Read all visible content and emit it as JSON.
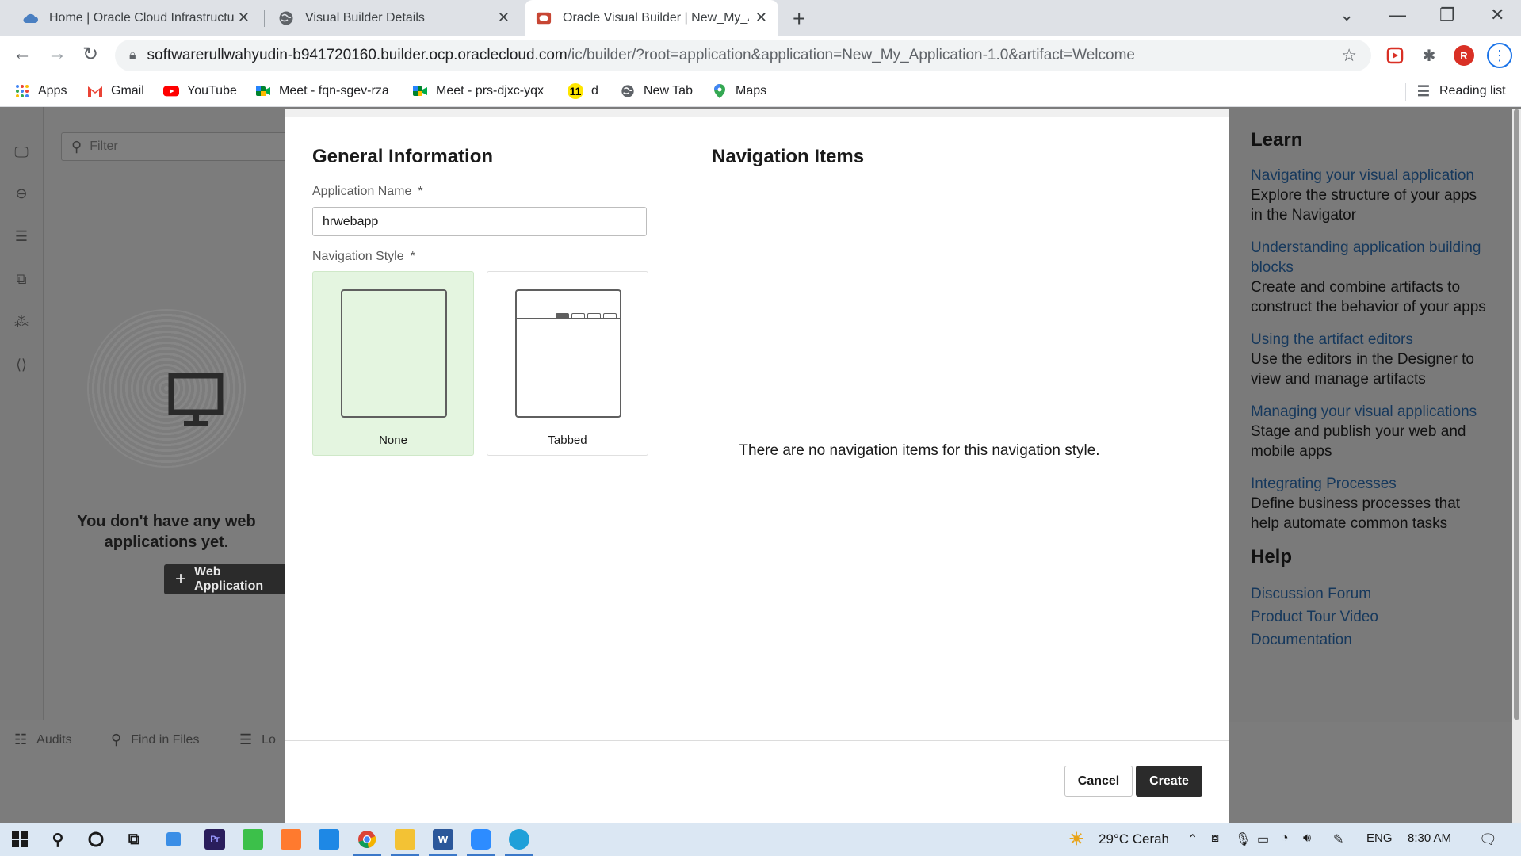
{
  "browser": {
    "tabs": [
      {
        "title": "Home | Oracle Cloud Infrastructu",
        "active": false
      },
      {
        "title": "Visual Builder Details",
        "active": false
      },
      {
        "title": "Oracle Visual Builder | New_My_A",
        "active": true
      }
    ],
    "url_host": "softwarerullwahyudin-b941720160.builder.ocp.oraclecloud.com",
    "url_path": "/ic/builder/?root=application&application=New_My_Application-1.0&artifact=Welcome",
    "bookmarks": [
      {
        "label": "Apps",
        "icon": "apps-grid-icon"
      },
      {
        "label": "Gmail",
        "icon": "gmail-icon"
      },
      {
        "label": "YouTube",
        "icon": "youtube-icon"
      },
      {
        "label": "Meet - fqn-sgev-rza",
        "icon": "meet-icon"
      },
      {
        "label": "Meet - prs-djxc-yqx",
        "icon": "meet-icon"
      },
      {
        "label": "d",
        "icon": "bookmark-11-icon"
      },
      {
        "label": "New Tab",
        "icon": "globe-icon"
      },
      {
        "label": "Maps",
        "icon": "maps-icon"
      }
    ],
    "reading_list": "Reading list",
    "profile_initial": "R"
  },
  "background_app": {
    "filter_placeholder": "Filter",
    "empty_message": "You don't have any web applications yet.",
    "web_app_button": "Web Application",
    "bottom_tabs": [
      "Audits",
      "Find in Files",
      "Lo"
    ]
  },
  "dialog": {
    "general_title": "General Information",
    "app_name_label": "Application Name",
    "app_name_value": "hrwebapp",
    "required_mark": "*",
    "nav_style_label": "Navigation Style",
    "nav_styles": [
      {
        "label": "None",
        "selected": true
      },
      {
        "label": "Tabbed",
        "selected": false
      }
    ],
    "nav_items_title": "Navigation Items",
    "nav_items_empty": "There are no navigation items for this navigation style.",
    "cancel_label": "Cancel",
    "create_label": "Create"
  },
  "learn_panel": {
    "learn_title": "Learn",
    "items": [
      {
        "link": "Navigating your visual application",
        "desc": "Explore the structure of your apps in the Navigator"
      },
      {
        "link": "Understanding application building blocks",
        "desc": "Create and combine artifacts to construct the behavior of your apps"
      },
      {
        "link": "Using the artifact editors",
        "desc": "Use the editors in the Designer to view and manage artifacts"
      },
      {
        "link": "Managing your visual applications",
        "desc": "Stage and publish your web and mobile apps"
      },
      {
        "link": "Integrating Processes",
        "desc": "Define business processes that help automate common tasks"
      }
    ],
    "help_title": "Help",
    "help_links": [
      "Discussion Forum",
      "Product Tour Video",
      "Documentation"
    ]
  },
  "taskbar": {
    "weather": "29°C  Cerah",
    "language": "ENG",
    "time": "8:30 AM"
  },
  "colors": {
    "selected_card": "#e4f5e0",
    "primary_button": "#2b2b2b",
    "link": "#16385c",
    "oracle_red": "#c74634"
  }
}
